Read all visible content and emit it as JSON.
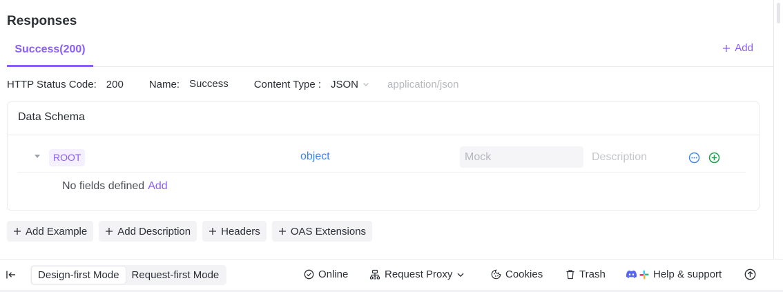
{
  "section_title": "Responses",
  "tabs": {
    "active": "Success(200)",
    "add_label": "Add"
  },
  "meta": {
    "status_label": "HTTP Status Code:",
    "status_value": "200",
    "name_label": "Name:",
    "name_value": "Success",
    "content_type_label": "Content Type :",
    "content_type_value": "JSON",
    "content_type_mime": "application/json"
  },
  "schema": {
    "title": "Data Schema",
    "root_label": "ROOT",
    "root_type": "object",
    "mock_placeholder": "Mock",
    "description_placeholder": "Description",
    "empty_text": "No fields defined",
    "empty_add": "Add"
  },
  "actions": {
    "add_example": "Add Example",
    "add_description": "Add Description",
    "headers": "Headers",
    "oas_extensions": "OAS Extensions"
  },
  "footer": {
    "design_mode": "Design-first Mode",
    "request_mode": "Request-first Mode",
    "online": "Online",
    "request_proxy": "Request Proxy",
    "cookies": "Cookies",
    "trash": "Trash",
    "help": "Help & support"
  },
  "colors": {
    "accent": "#8b5cf6",
    "type_blue": "#3b82f6",
    "add_green": "#16a34a"
  },
  "icons": [
    "plus-icon",
    "chevron-down-icon",
    "caret-down-icon",
    "more-icon",
    "add-circle-icon",
    "collapse-sidebar-icon",
    "online-check-icon",
    "proxy-icon",
    "cookie-icon",
    "trash-icon",
    "discord-icon",
    "slack-icon",
    "upload-arrow-icon"
  ]
}
